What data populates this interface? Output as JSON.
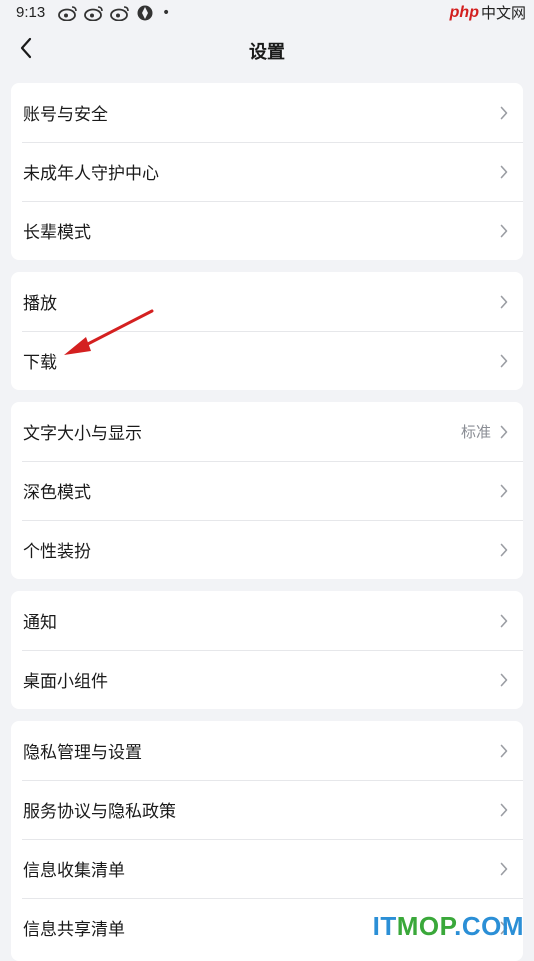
{
  "status_bar": {
    "time": "9:13",
    "icons": [
      "weibo-icon",
      "weibo-icon",
      "weibo-icon",
      "shutter-icon"
    ],
    "dot": "•",
    "watermark_logo": "php",
    "watermark_text": "中文网"
  },
  "header": {
    "title": "设置",
    "back_icon": "chevron-left-icon"
  },
  "groups": [
    {
      "items": [
        {
          "label": "账号与安全"
        },
        {
          "label": "未成年人守护中心"
        },
        {
          "label": "长辈模式"
        }
      ]
    },
    {
      "items": [
        {
          "label": "播放"
        },
        {
          "label": "下载"
        }
      ]
    },
    {
      "items": [
        {
          "label": "文字大小与显示",
          "value": "标准"
        },
        {
          "label": "深色模式"
        },
        {
          "label": "个性装扮"
        }
      ]
    },
    {
      "items": [
        {
          "label": "通知"
        },
        {
          "label": "桌面小组件"
        }
      ]
    },
    {
      "items": [
        {
          "label": "隐私管理与设置"
        },
        {
          "label": "服务协议与隐私政策"
        },
        {
          "label": "信息收集清单"
        },
        {
          "label": "信息共享清单"
        }
      ]
    }
  ],
  "annotation": {
    "color": "#d42020",
    "target": "下载"
  },
  "watermark": {
    "it": "IT",
    "mop": "MOP",
    "com": ".COM"
  },
  "colors": {
    "background": "#f2f3f6",
    "card": "#ffffff",
    "secondary_text": "#8a8d94"
  }
}
